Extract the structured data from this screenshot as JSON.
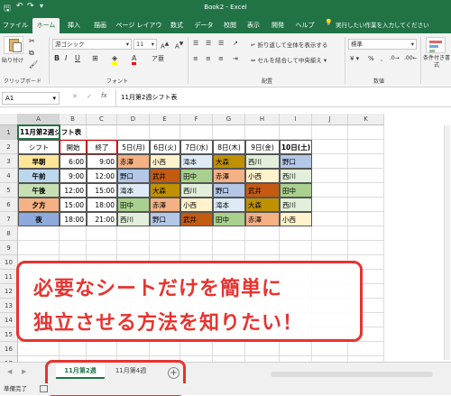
{
  "titlebar": {
    "title": "Book2 - Excel"
  },
  "ribbon_tabs": [
    {
      "label": "ファイル",
      "active": false
    },
    {
      "label": "ホーム",
      "active": true
    },
    {
      "label": "挿入",
      "active": false
    },
    {
      "label": "描画",
      "active": false
    },
    {
      "label": "ページ レイアウト",
      "active": false
    },
    {
      "label": "数式",
      "active": false
    },
    {
      "label": "データ",
      "active": false
    },
    {
      "label": "校閲",
      "active": false
    },
    {
      "label": "表示",
      "active": false
    },
    {
      "label": "開発",
      "active": false
    },
    {
      "label": "ヘルプ",
      "active": false
    }
  ],
  "tell_me": {
    "placeholder": "実行したい作業を入力してください"
  },
  "ribbon": {
    "paste_label": "貼り付け",
    "font_name": "游ゴシック",
    "font_size": "11",
    "wrap_text": "折り返して全体を表示する",
    "merge_center": "セルを結合して中央揃え",
    "number_format": "標準",
    "conditional_format": "条件付き書式",
    "groups": {
      "clipboard": "クリップボード",
      "font": "フォント",
      "alignment": "配置",
      "number": "数値"
    }
  },
  "formula_bar": {
    "name_box": "A1",
    "fx": "fx",
    "content": "11月第2週シフト表"
  },
  "columns": [
    "A",
    "B",
    "C",
    "D",
    "E",
    "F",
    "G",
    "H",
    "I",
    "J",
    "K"
  ],
  "rows": [
    "1",
    "2",
    "3",
    "4",
    "5",
    "6",
    "7",
    "8",
    "9",
    "10",
    "11",
    "12",
    "13",
    "14",
    "15",
    "16",
    "17"
  ],
  "sheet": {
    "title": "11月第2週シフト表",
    "headers": [
      "シフト",
      "開始",
      "終了",
      "5日(月)",
      "6日(火)",
      "7日(水)",
      "8日(木)",
      "9日(金)",
      "10日(土)"
    ],
    "shifts": [
      {
        "name": "早朝",
        "start": "6:00",
        "end": "9:00",
        "names": [
          "赤澤",
          "小西",
          "滝本",
          "大森",
          "西川",
          "野口"
        ]
      },
      {
        "name": "午前",
        "start": "9:00",
        "end": "12:00",
        "names": [
          "野口",
          "武井",
          "田中",
          "赤澤",
          "小西",
          "西川"
        ]
      },
      {
        "name": "午後",
        "start": "12:00",
        "end": "15:00",
        "names": [
          "滝本",
          "大森",
          "西川",
          "野口",
          "武井",
          "田中"
        ]
      },
      {
        "name": "夕方",
        "start": "15:00",
        "end": "18:00",
        "names": [
          "田中",
          "赤澤",
          "小西",
          "滝本",
          "大森",
          "西川"
        ]
      },
      {
        "name": "夜",
        "start": "18:00",
        "end": "21:00",
        "names": [
          "西川",
          "野口",
          "武井",
          "田中",
          "赤澤",
          "小西"
        ]
      }
    ]
  },
  "name_colors": {
    "赤澤": "#f4b183",
    "小西": "#fff2cc",
    "滝本": "#deebf7",
    "大森": "#bf9000",
    "西川": "#e2efda",
    "野口": "#b4c7e7",
    "武井": "#c55a11",
    "田中": "#a9d08e"
  },
  "shift_colors": [
    "#ffe699",
    "#bdd7ee",
    "#c6e0b4",
    "#f4b183",
    "#8ea9db"
  ],
  "sheet_tabs": [
    {
      "label": "11月第2週",
      "active": true
    },
    {
      "label": "11月第4週",
      "active": false
    }
  ],
  "status": {
    "ready": "準備完了"
  },
  "callout": {
    "line1": "必要なシートだけを簡単に",
    "line2": "独立させる方法を知りたい！"
  },
  "accent": "#217346",
  "highlight": "#e8332f"
}
